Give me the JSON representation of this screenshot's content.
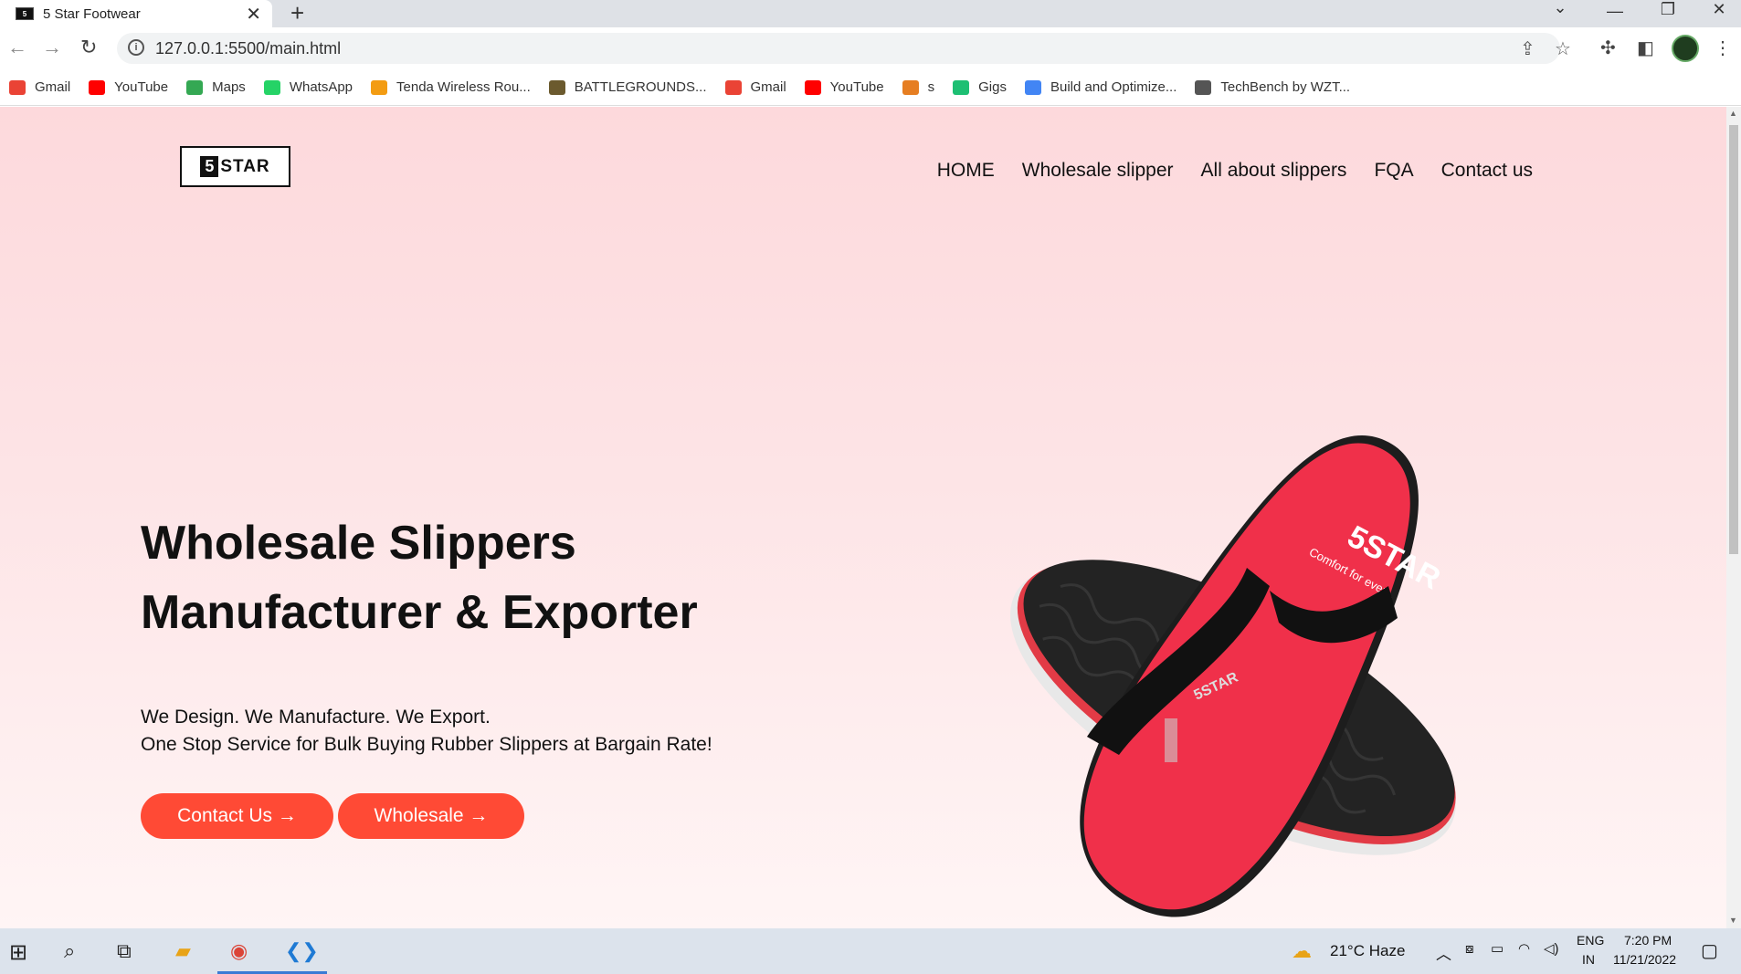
{
  "browser": {
    "tab_title": "5 Star Footwear",
    "favicon_text": "5",
    "url": "127.0.0.1:5500/main.html",
    "bookmarks": [
      {
        "label": "Gmail",
        "color": "#ea4335"
      },
      {
        "label": "YouTube",
        "color": "#ff0000"
      },
      {
        "label": "Maps",
        "color": "#34a853"
      },
      {
        "label": "WhatsApp",
        "color": "#25d366"
      },
      {
        "label": "Tenda Wireless Rou...",
        "color": "#f39c12"
      },
      {
        "label": "BATTLEGROUNDS...",
        "color": "#6b5a2e"
      },
      {
        "label": "Gmail",
        "color": "#ea4335"
      },
      {
        "label": "YouTube",
        "color": "#ff0000"
      },
      {
        "label": "s",
        "color": "#e67e22"
      },
      {
        "label": "Gigs",
        "color": "#1dbf73"
      },
      {
        "label": "Build and Optimize...",
        "color": "#4285f4"
      },
      {
        "label": "TechBench by WZT...",
        "color": "#555555"
      }
    ]
  },
  "site": {
    "logo_number": "5",
    "logo_text": "STAR",
    "nav": [
      "HOME",
      "Wholesale slipper",
      "All about slippers",
      "FQA",
      "Contact us"
    ],
    "hero_title_line1": "Wholesale Slippers",
    "hero_title_line2": "Manufacturer & Exporter",
    "hero_sub_line1": "We Design. We Manufacture. We Export.",
    "hero_sub_line2": "One Stop Service for Bulk Buying Rubber Slippers at Bargain Rate!",
    "btn_contact": "Contact Us →",
    "btn_wholesale": "Wholesale →",
    "slipper_brand": "5STAR",
    "slipper_tagline": "Comfort for ever...",
    "accent_color": "#ff4a35"
  },
  "taskbar": {
    "weather": "21°C  Haze",
    "lang_line1": "ENG",
    "lang_line2": "IN",
    "time": "7:20 PM",
    "date": "11/21/2022"
  }
}
